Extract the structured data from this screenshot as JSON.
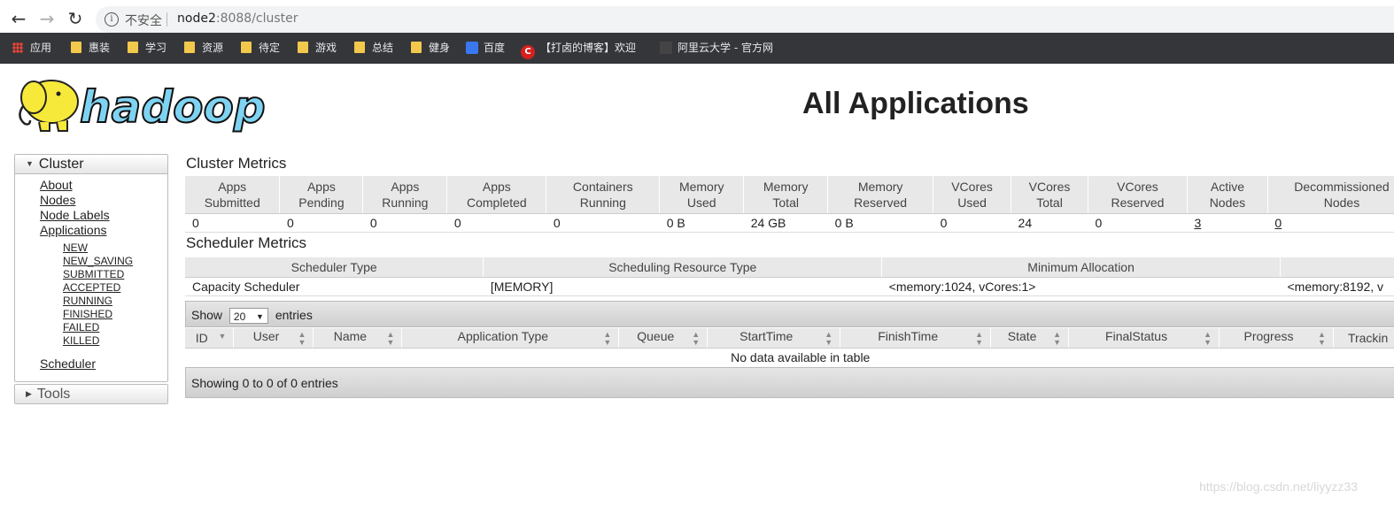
{
  "browser": {
    "security_label": "不安全",
    "url_host": "node2",
    "url_rest": ":8088/cluster",
    "bookmarks": [
      "应用",
      "惠装",
      "学习",
      "资源",
      "待定",
      "游戏",
      "总结",
      "健身",
      "百度",
      "【打卤的博客】欢迎",
      "阿里云大学 - 官方网"
    ]
  },
  "header": {
    "logo_text": "hadoop",
    "title": "All Applications"
  },
  "sidebar": {
    "cluster_title": "Cluster",
    "links": [
      "About",
      "Nodes",
      "Node Labels",
      "Applications"
    ],
    "app_states": [
      "NEW",
      "NEW_SAVING",
      "SUBMITTED",
      "ACCEPTED",
      "RUNNING",
      "FINISHED",
      "FAILED",
      "KILLED"
    ],
    "scheduler": "Scheduler",
    "tools_title": "Tools"
  },
  "cluster_metrics": {
    "title": "Cluster Metrics",
    "headers": [
      [
        "Apps",
        "Submitted"
      ],
      [
        "Apps",
        "Pending"
      ],
      [
        "Apps",
        "Running"
      ],
      [
        "Apps",
        "Completed"
      ],
      [
        "Containers",
        "Running"
      ],
      [
        "Memory",
        "Used"
      ],
      [
        "Memory",
        "Total"
      ],
      [
        "Memory",
        "Reserved"
      ],
      [
        "VCores",
        "Used"
      ],
      [
        "VCores",
        "Total"
      ],
      [
        "VCores",
        "Reserved"
      ],
      [
        "Active",
        "Nodes"
      ],
      [
        "Decommissioned",
        "Nodes"
      ]
    ],
    "values": [
      "0",
      "0",
      "0",
      "0",
      "0",
      "0 B",
      "24 GB",
      "0 B",
      "0",
      "24",
      "0",
      "3",
      "0"
    ]
  },
  "scheduler_metrics": {
    "title": "Scheduler Metrics",
    "headers": [
      "Scheduler Type",
      "Scheduling Resource Type",
      "Minimum Allocation",
      ""
    ],
    "values": [
      "Capacity Scheduler",
      "[MEMORY]",
      "<memory:1024, vCores:1>",
      "<memory:8192, v"
    ]
  },
  "apps_table": {
    "show_label": "Show",
    "page_size": "20",
    "entries_label": "entries",
    "columns": [
      "ID",
      "User",
      "Name",
      "Application Type",
      "Queue",
      "StartTime",
      "FinishTime",
      "State",
      "FinalStatus",
      "Progress",
      "Trackin"
    ],
    "empty_message": "No data available in table",
    "info": "Showing 0 to 0 of 0 entries"
  },
  "watermark": "https://blog.csdn.net/liyyzz33"
}
